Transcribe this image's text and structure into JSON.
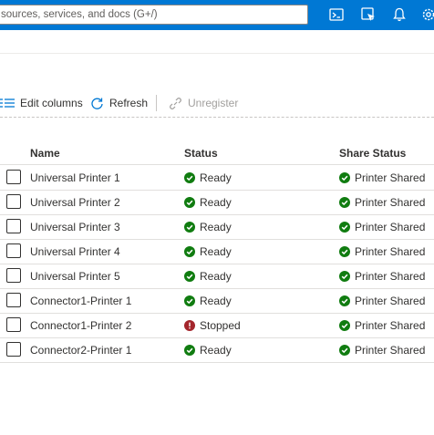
{
  "header": {
    "search_placeholder": "sources, services, and docs (G+/)",
    "icons": [
      "cloud-shell-icon",
      "directory-filter-icon",
      "notifications-icon",
      "settings-icon"
    ]
  },
  "toolbar": {
    "edit_columns_label": "Edit columns",
    "refresh_label": "Refresh",
    "unregister_label": "Unregister"
  },
  "table": {
    "columns": {
      "name": "Name",
      "status": "Status",
      "share_status": "Share Status"
    },
    "rows": [
      {
        "name": "Universal Printer 1",
        "status": "Ready",
        "share_status": "Printer Shared"
      },
      {
        "name": "Universal Printer 2",
        "status": "Ready",
        "share_status": "Printer Shared"
      },
      {
        "name": "Universal Printer 3",
        "status": "Ready",
        "share_status": "Printer Shared"
      },
      {
        "name": "Universal Printer 4",
        "status": "Ready",
        "share_status": "Printer Shared"
      },
      {
        "name": "Universal Printer 5",
        "status": "Ready",
        "share_status": "Printer Shared"
      },
      {
        "name": "Connector1-Printer 1",
        "status": "Ready",
        "share_status": "Printer Shared"
      },
      {
        "name": "Connector1-Printer 2",
        "status": "Stopped",
        "share_status": "Printer Shared"
      },
      {
        "name": "Connector2-Printer 1",
        "status": "Ready",
        "share_status": "Printer Shared"
      }
    ]
  },
  "colors": {
    "topbar": "#0078d4",
    "ok": "#107c10",
    "error": "#a4262c",
    "accent": "#0078d4"
  }
}
